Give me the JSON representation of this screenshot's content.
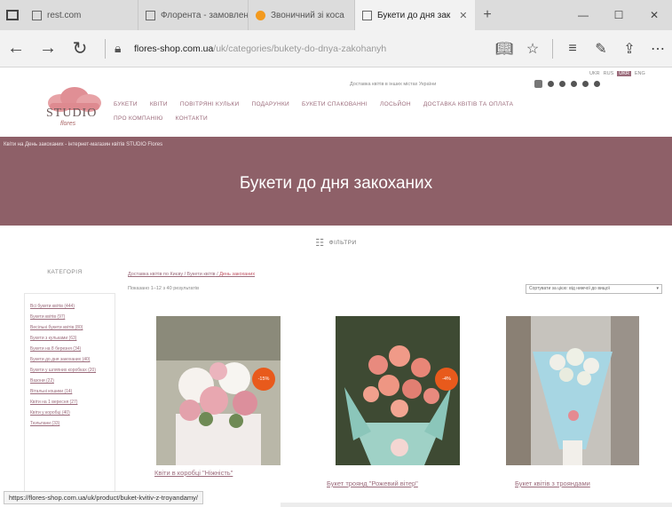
{
  "browser": {
    "tabs": [
      {
        "label": "rest.com",
        "icon": "page-icon"
      },
      {
        "label": "Флорента - замовлен",
        "icon": "page-icon"
      },
      {
        "label": "Звоничний зі коса",
        "icon": "fox-icon"
      },
      {
        "label": "Букети до дня зак",
        "icon": "page-icon",
        "active": true
      }
    ],
    "new_tab": "+",
    "address": {
      "domain": "flores-shop.com.ua",
      "path": "/uk/categories/bukety-do-dnya-zakohanyh"
    }
  },
  "site": {
    "logo_text": "STUDIO",
    "logo_sub": "flores",
    "menu": [
      "БУКЕТИ",
      "КВІТИ",
      "ПОВІТРЯНІ КУЛЬКИ",
      "ПОДАРУНКИ",
      "БУКЕТИ СПАКОВАННІ",
      "ЛОСЬЙОН",
      "ДОСТАВКА КВІТІВ ТА ОПЛАТА",
      "ПРО КОМПАНІЮ",
      "КОНТАКТИ"
    ],
    "topline": "Доставка квітів в інших містах України",
    "lang": {
      "a": "UKR",
      "b": "RUS",
      "current": "UKR",
      "c": "ENG"
    }
  },
  "banner": {
    "crumbs": "Квіти на День закоханих - інтернет-магазин квітів STUDIO Flores",
    "title": "Букети до дня закоханих"
  },
  "filter": {
    "label": "ФІЛЬТРИ"
  },
  "sidebar": {
    "title": "КАТЕГОРІЯ",
    "items": [
      "Всі букети квітів (444)",
      "Букети квітів (97)",
      "Весільні букети квітів (80)",
      "Букети з кульками (63)",
      "Букети на 8 березня (34)",
      "Букети до дня закоханих (40)",
      "Букети у шляпних коробках (20)",
      "Вазони (22)",
      "Вітальні кошики (14)",
      "Квіти на 1 вересня (27)",
      "Квіти у коробці (40)",
      "Тюльпани (33)"
    ]
  },
  "content": {
    "breadcrumb": {
      "a": "Доставка квітів по Києву",
      "b": "Букети квітів",
      "current": "День закоханих"
    },
    "results": "Показано 1–12 з 40 результатів",
    "sort": "Сортувати за цією: від нижчої до вищої"
  },
  "products": [
    {
      "name": "Квіти в коробці \"Ніжність\"",
      "badge": "-15%"
    },
    {
      "name": "Букет троянд \"Рожевий вітер\"",
      "badge": "-4%"
    },
    {
      "name": "Букет квітів з трояндами",
      "badge": null
    }
  ],
  "statusbar": "https://flores-shop.com.ua/uk/product/buket-kvitiv-z-troyandamy/",
  "colors": {
    "accent": "#8e6068",
    "link": "#9b6b7b",
    "badge": "#e85a1c"
  }
}
